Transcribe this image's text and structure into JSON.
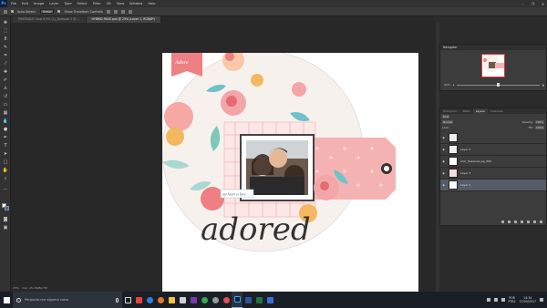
{
  "menubar": {
    "logo": "Ps",
    "items": [
      "File",
      "Edit",
      "Image",
      "Layer",
      "Type",
      "Select",
      "Filter",
      "3D",
      "View",
      "Window",
      "Help"
    ]
  },
  "options": {
    "auto_select_label": "Auto-Select:",
    "auto_select_value": "Group",
    "show_transform_label": "Show Transform Controls"
  },
  "tabs": [
    {
      "label": "PRINTABLE Card ili 5% (1)_Notepad 2 @ ...",
      "active": false
    },
    {
      "label": "HYBRID PAGE.psd @ 25% (Layer 1, RGB/8*)",
      "active": true
    }
  ],
  "statusbar": {
    "zoom": "25%",
    "doc_size": "Doc: 25,1M/80,7M"
  },
  "navigator": {
    "title": "Navigator",
    "zoom": "25%"
  },
  "layers": {
    "tabs": [
      "Histogram",
      "Paths",
      "Layers",
      "Channels"
    ],
    "active_tab": "Layers",
    "kind_label": "Kind",
    "blend_mode": "Normal",
    "opacity_label": "Opacity:",
    "opacity_value": "100%",
    "lock_label": "Lock:",
    "fill_label": "Fill:",
    "fill_value": "100%",
    "items": [
      {
        "name": "",
        "selected": false
      },
      {
        "name": "Layer 2",
        "selected": false
      },
      {
        "name": "UCC_Seasonal_pp_060",
        "selected": false
      },
      {
        "name": "Layer 3",
        "selected": false
      },
      {
        "name": "Layer 1",
        "selected": true
      }
    ]
  },
  "canvas": {
    "title_word": "adored",
    "tag_text": "my heart is here",
    "corner_label": "Adore"
  },
  "taskbar": {
    "search_placeholder": "Pergunte-me alguma coisa",
    "lang": "POR",
    "region": "PTB2",
    "time": "14:34",
    "date": "27/05/2017"
  },
  "colors": {
    "accent_pink": "#ee7f83",
    "accent_teal": "#6fc3c6",
    "accent_orange": "#f4b860",
    "ps_blue": "#31a8ff"
  }
}
